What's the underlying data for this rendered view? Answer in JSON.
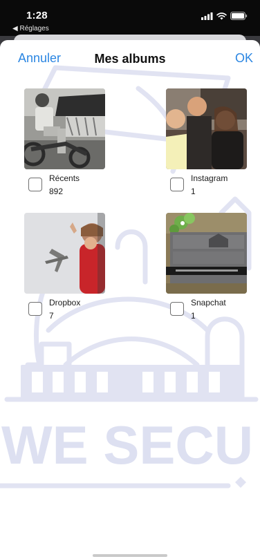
{
  "status_bar": {
    "time": "1:28",
    "back_app": "◀ Réglages",
    "icons": [
      "signal-icon",
      "wifi-icon",
      "battery-icon"
    ]
  },
  "nav": {
    "cancel_label": "Annuler",
    "title": "Mes albums",
    "ok_label": "OK"
  },
  "albums": [
    {
      "name": "Récents",
      "count": "892",
      "selected": false
    },
    {
      "name": "Instagram",
      "count": "1",
      "selected": false
    },
    {
      "name": "Dropbox",
      "count": "7",
      "selected": false
    },
    {
      "name": "Snapchat",
      "count": "1",
      "selected": false
    }
  ],
  "watermark": {
    "text": "WE SECU"
  },
  "colors": {
    "accent": "#2b86e2",
    "sheet_background": "#ffffff",
    "watermark": "#dcdff0"
  }
}
